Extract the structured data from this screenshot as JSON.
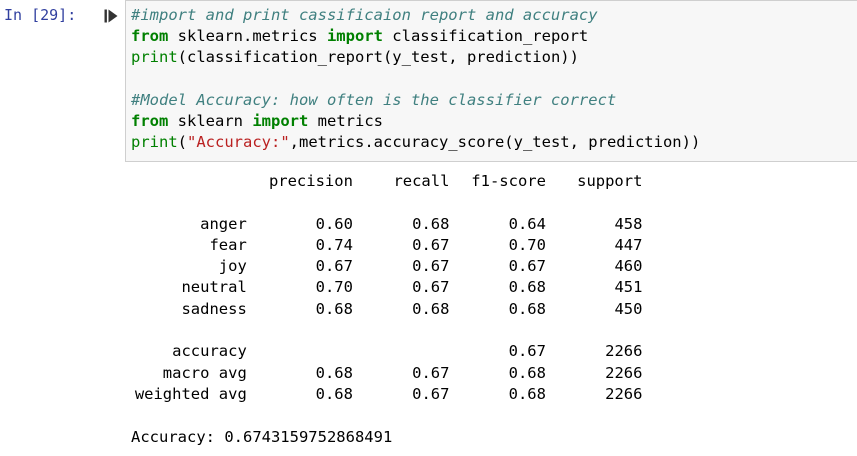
{
  "prompt": "In [29]:",
  "code_lines": [
    {
      "comment": "#import and print cassificaion report and accuracy"
    },
    {
      "kw1": "from",
      "mid": " sklearn.metrics ",
      "kw2": "import",
      "rest": " classification_report"
    },
    {
      "builtin": "print",
      "rest": "(classification_report(y_test, prediction))"
    },
    {
      "blank": ""
    },
    {
      "comment": "#Model Accuracy: how often is the classifier correct"
    },
    {
      "kw1": "from",
      "mid": " sklearn ",
      "kw2": "import",
      "rest": " metrics"
    },
    {
      "builtin": "print",
      "open": "(",
      "str": "\"Accuracy:\"",
      "rest": ",metrics.accuracy_score(y_test, prediction))"
    }
  ],
  "report": {
    "headers": [
      "precision",
      "recall",
      "f1-score",
      "support"
    ],
    "rows": [
      {
        "label": "anger",
        "precision": "0.60",
        "recall": "0.68",
        "f1": "0.64",
        "support": "458"
      },
      {
        "label": "fear",
        "precision": "0.74",
        "recall": "0.67",
        "f1": "0.70",
        "support": "447"
      },
      {
        "label": "joy",
        "precision": "0.67",
        "recall": "0.67",
        "f1": "0.67",
        "support": "460"
      },
      {
        "label": "neutral",
        "precision": "0.70",
        "recall": "0.67",
        "f1": "0.68",
        "support": "451"
      },
      {
        "label": "sadness",
        "precision": "0.68",
        "recall": "0.68",
        "f1": "0.68",
        "support": "450"
      }
    ],
    "summary": [
      {
        "label": "accuracy",
        "precision": "",
        "recall": "",
        "f1": "0.67",
        "support": "2266"
      },
      {
        "label": "macro avg",
        "precision": "0.68",
        "recall": "0.67",
        "f1": "0.68",
        "support": "2266"
      },
      {
        "label": "weighted avg",
        "precision": "0.68",
        "recall": "0.67",
        "f1": "0.68",
        "support": "2266"
      }
    ]
  },
  "accuracy_line": "Accuracy: 0.6743159752868491",
  "colors": {
    "prompt": "#303f9f",
    "keyword": "#008000",
    "comment": "#408080",
    "string": "#ba2121",
    "input_bg": "#f7f7f7"
  },
  "icons": {
    "run": "run-cell-icon"
  }
}
